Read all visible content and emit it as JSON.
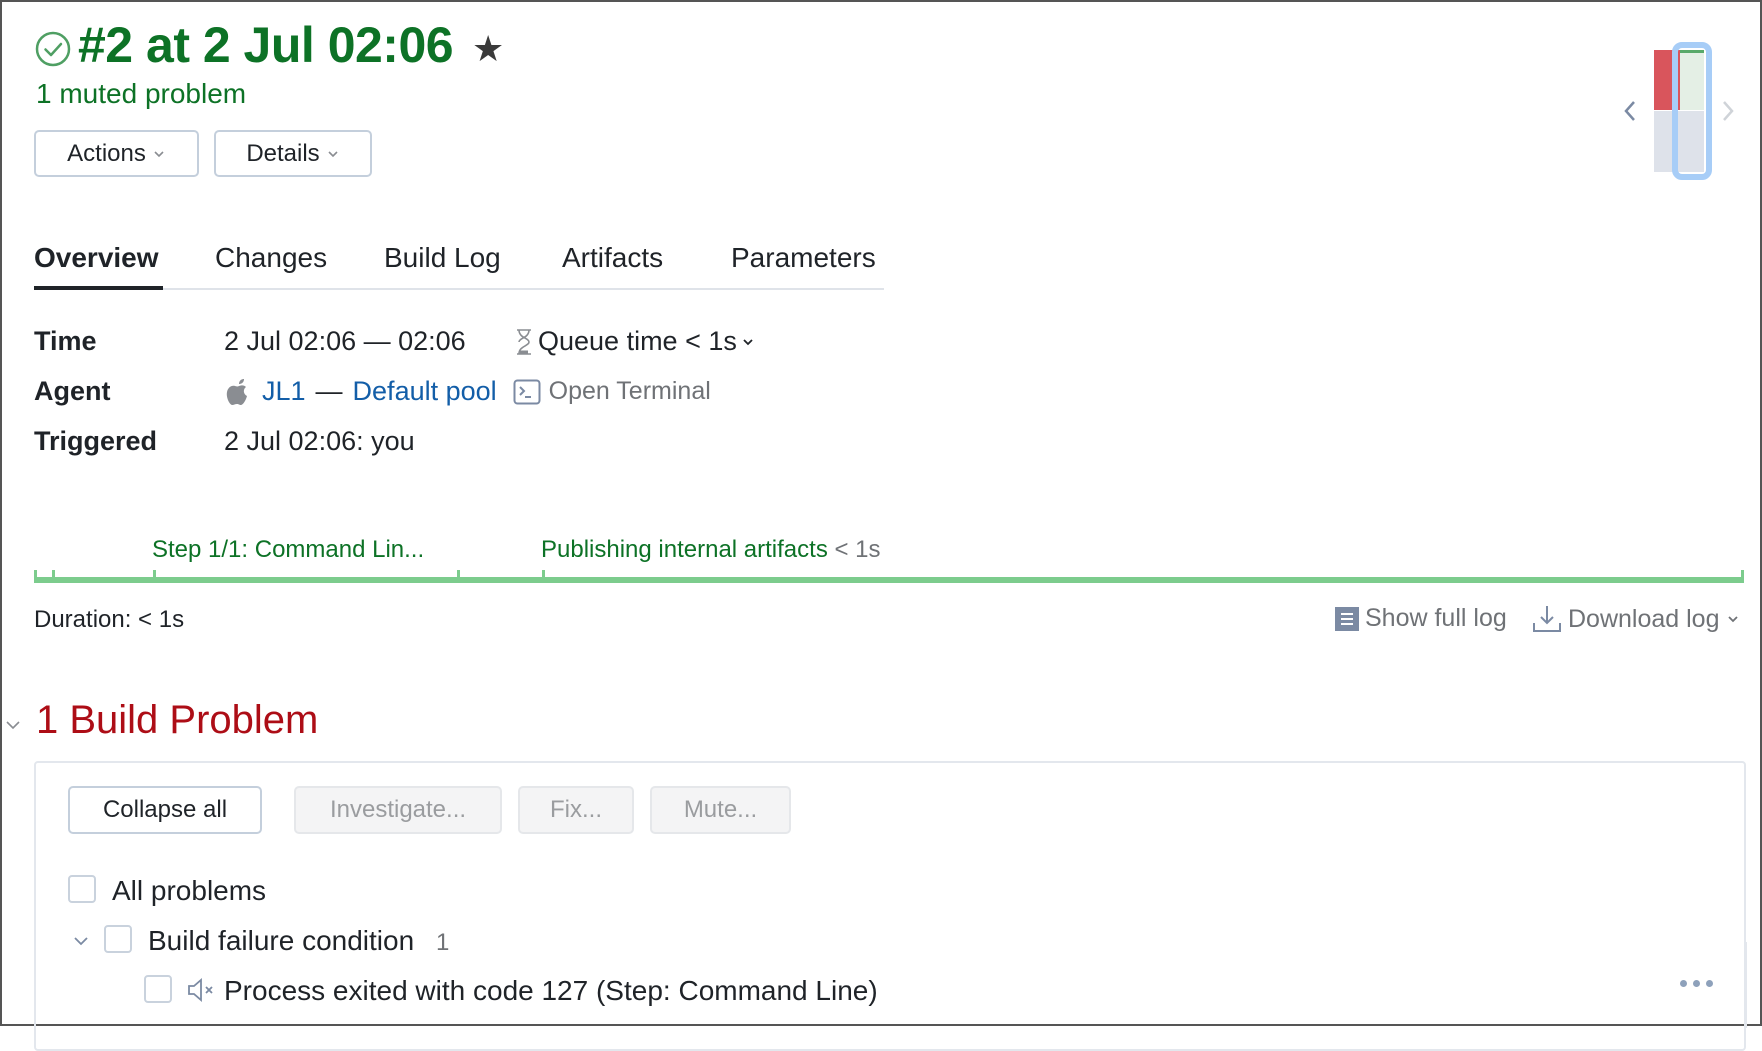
{
  "header": {
    "title": "#2 at 2 Jul 02:06",
    "status": "success",
    "subtitle": "1 muted problem",
    "actions_label": "Actions",
    "details_label": "Details",
    "accent_color": "#0d7226"
  },
  "build_history": {
    "builds": [
      {
        "status": "failed",
        "color": "#d9555c"
      },
      {
        "status": "success",
        "selected": true,
        "color": "#58a96a"
      }
    ]
  },
  "tabs": [
    {
      "label": "Overview",
      "active": true
    },
    {
      "label": "Changes"
    },
    {
      "label": "Build Log"
    },
    {
      "label": "Artifacts"
    },
    {
      "label": "Parameters"
    }
  ],
  "info": {
    "time_label": "Time",
    "time_value": "2 Jul 02:06 — 02:06",
    "queue_time": "Queue time < 1s",
    "agent_label": "Agent",
    "agent_name": "JL1",
    "agent_sep": "—",
    "agent_pool": "Default pool",
    "open_terminal": "Open Terminal",
    "triggered_label": "Triggered",
    "triggered_value": "2 Jul 02:06: you"
  },
  "timeline": {
    "step1": "Step 1/1: Command Lin...",
    "step2": "Publishing internal artifacts",
    "step2_duration": "< 1s",
    "duration": "Duration: < 1s",
    "show_full_log": "Show full log",
    "download_log": "Download log"
  },
  "problems": {
    "title": "1 Build Problem",
    "collapse_all": "Collapse all",
    "investigate": "Investigate...",
    "fix": "Fix...",
    "mute": "Mute...",
    "all_problems": "All problems",
    "group_label": "Build failure condition",
    "group_count": "1",
    "item_label": "Process exited with code 127 (Step: Command Line)"
  }
}
